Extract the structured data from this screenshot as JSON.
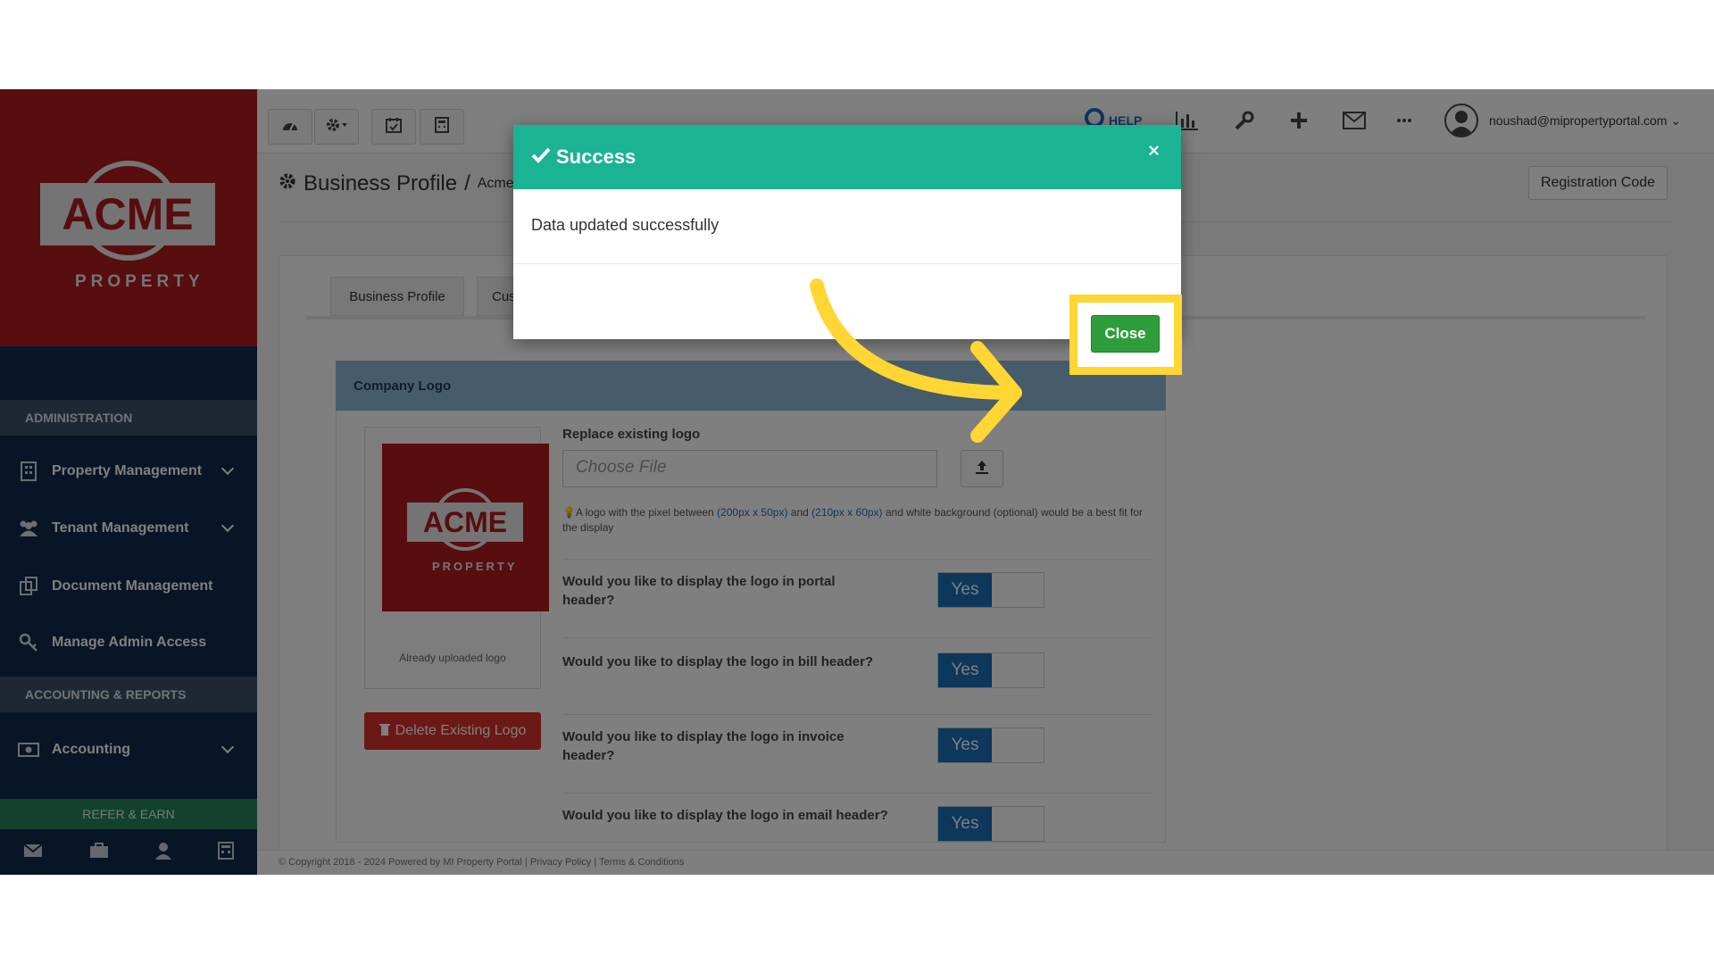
{
  "colors": {
    "sidebar_bg": "#0f2a4d",
    "logo_red": "#b11b1f",
    "success_header": "#1ab394",
    "close_button": "#2e9e3c",
    "highlight": "#ffd633",
    "toggle_yes": "#1d6fb8",
    "delete_red": "#d9312c"
  },
  "brand": {
    "logo_text": "ACME",
    "logo_subtext": "PROPERTY"
  },
  "sidebar": {
    "sections": [
      {
        "label": "ADMINISTRATION"
      },
      {
        "label": "ACCOUNTING & REPORTS"
      }
    ],
    "items": [
      {
        "label": "Property Management",
        "icon": "building-icon"
      },
      {
        "label": "Tenant Management",
        "icon": "users-icon"
      },
      {
        "label": "Document Management",
        "icon": "documents-icon"
      },
      {
        "label": "Manage Admin Access",
        "icon": "key-icon"
      },
      {
        "label": "Accounting",
        "icon": "money-icon"
      }
    ],
    "refer": "REFER & EARN"
  },
  "topbar": {
    "help": "HELP",
    "user_email": "noushad@mipropertyportal.com"
  },
  "page": {
    "title": "Business Profile",
    "separator": "/",
    "breadcrumb_tail": "Acme",
    "registration_button": "Registration Code"
  },
  "tabs": [
    {
      "label": "Business Profile"
    },
    {
      "label": "Cus"
    }
  ],
  "logo_section": {
    "heading": "Company Logo",
    "uploaded_caption": "Already uploaded logo",
    "delete_button": "Delete Existing Logo",
    "replace_label": "Replace existing logo",
    "file_placeholder": "Choose File",
    "hint_prefix": "A logo with the pixel between ",
    "hint_size1": "(200px x 50px)",
    "hint_and": " and ",
    "hint_size2": "(210px x 60px)",
    "hint_suffix": " and white background (optional) would be a best fit for the display",
    "questions": [
      {
        "text": "Would you like to display the logo in portal header?",
        "value": "Yes"
      },
      {
        "text": "Would you like to display the logo in bill header?",
        "value": "Yes"
      },
      {
        "text": "Would you like to display the logo in invoice header?",
        "value": "Yes"
      },
      {
        "text": "Would you like to display the logo in email header?",
        "value": "Yes"
      }
    ]
  },
  "footer": {
    "text": "© Copyright 2018 - 2024 Powered by MI Property Portal | Privacy Policy | Terms & Conditions"
  },
  "modal": {
    "title": "Success",
    "close_x": "×",
    "message": "Data updated successfully",
    "close_button": "Close"
  }
}
